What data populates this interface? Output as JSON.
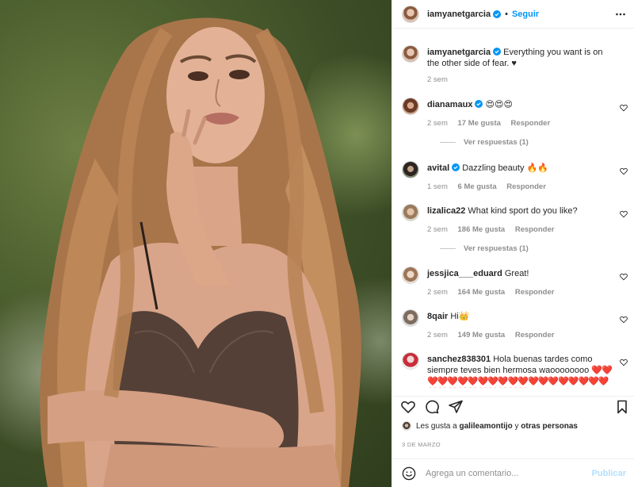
{
  "post": {
    "username": "iamyanetgarcia",
    "follow_label": "Seguir",
    "dot": "•",
    "caption": "Everything you want is on the other side of fear. ♥",
    "caption_time": "2 sem"
  },
  "comments": [
    {
      "user": "dianamaux",
      "verified": true,
      "text": "😍😍😍",
      "time": "2 sem",
      "likes": "17 Me gusta",
      "reply": "Responder",
      "view_replies": "Ver respuestas (1)"
    },
    {
      "user": "avital",
      "verified": true,
      "text": "Dazzling beauty 🔥🔥",
      "time": "1 sem",
      "likes": "6 Me gusta",
      "reply": "Responder"
    },
    {
      "user": "lizalica22",
      "verified": false,
      "text": "What kind sport do you like?",
      "time": "2 sem",
      "likes": "186 Me gusta",
      "reply": "Responder",
      "view_replies": "Ver respuestas (1)"
    },
    {
      "user": "jessjica___eduard",
      "verified": false,
      "text": "Great!",
      "time": "2 sem",
      "likes": "164 Me gusta",
      "reply": "Responder"
    },
    {
      "user": "8qair",
      "verified": false,
      "text": "Hi👑",
      "time": "2 sem",
      "likes": "149 Me gusta",
      "reply": "Responder"
    },
    {
      "user": "sanchez838301",
      "verified": false,
      "text": "Hola buenas tardes como siempre teves bien hermosa waoooooooo",
      "hearts": "❤️❤️❤️❤️❤️❤️❤️❤️❤️❤️❤️❤️❤️❤️❤️❤️❤️❤️❤️❤️❤️❤️❤️❤️❤️❤️❤️❤️❤️❤️"
    }
  ],
  "likes": {
    "prefix": "Les gusta a",
    "user": "galileamontijo",
    "joiner": "y",
    "others": "otras personas"
  },
  "date": "3 DE MARZO",
  "composer": {
    "placeholder": "Agrega un comentario...",
    "publish": "Publicar"
  },
  "colors": {
    "accent": "#0095f6",
    "muted": "#8e8e8e",
    "publish_disabled": "#b2dffc",
    "heart": "#ed4956"
  }
}
